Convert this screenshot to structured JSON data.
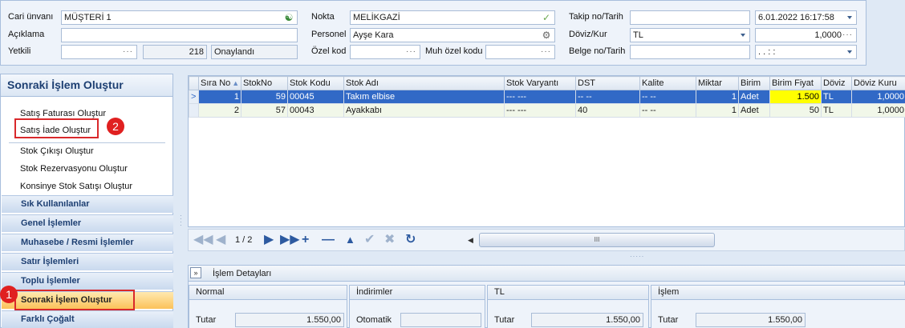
{
  "header": {
    "cari_label": "Cari ünvanı",
    "cari_value": "MÜŞTERİ 1",
    "aciklama_label": "Açıklama",
    "yetkili_label": "Yetkili",
    "yetkili_dots": "···",
    "count": "218",
    "status": "Onaylandı",
    "nokta_label": "Nokta",
    "nokta_value": "MELİKGAZİ",
    "personel_label": "Personel",
    "personel_value": "Ayşe Kara",
    "ozelkod_label": "Özel kod",
    "ozelkod_dots": "···",
    "muhozelkod_label": "Muh özel kodu",
    "muhozelkod_dots": "···",
    "takip_label": "Takip no/Tarih",
    "takip_date": "6.01.2022 16:17:58",
    "doviz_label": "Döviz/Kur",
    "doviz_value": "TL",
    "kur_value": "1,0000",
    "kur_dots": "···",
    "belge_label": "Belge no/Tarih",
    "belge_date": ".   .     :   :"
  },
  "left_panel": {
    "title": "Sonraki İşlem Oluştur",
    "items": [
      "Satış Faturası Oluştur",
      "Satış İade Oluştur",
      "Stok Çıkışı Oluştur",
      "Stok Rezervasyonu Oluştur",
      "Konsinye Stok Satışı Oluştur"
    ],
    "groups": [
      "Sık Kullanılanlar",
      "Genel İşlemler",
      "Muhasebe / Resmi İşlemler",
      "Satır İşlemleri",
      "Toplu İşlemler",
      "Sonraki İşlem Oluştur",
      "Farklı Çoğalt"
    ],
    "badge1": "1",
    "badge2": "2"
  },
  "grid": {
    "columns": [
      "Sıra No",
      "StokNo",
      "Stok Kodu",
      "Stok Adı",
      "Stok Varyantı",
      "DST",
      "Kalite",
      "Miktar",
      "Birim",
      "Birim Fiyat",
      "Döviz",
      "Döviz Kuru"
    ],
    "rows": [
      {
        "indicator": ">",
        "sira": "1",
        "stokno": "59",
        "kod": "00045",
        "ad": "Takım elbise",
        "varyant": "--- ---",
        "dst": "-- --",
        "kalite": "-- --",
        "miktar": "1",
        "birim": "Adet",
        "fiyat": "1.500",
        "doviz": "TL",
        "kur": "1,0000"
      },
      {
        "indicator": "",
        "sira": "2",
        "stokno": "57",
        "kod": "00043",
        "ad": "Ayakkabı",
        "varyant": "--- ---",
        "dst": "40",
        "kalite": "-- --",
        "miktar": "1",
        "birim": "Adet",
        "fiyat": "50",
        "doviz": "TL",
        "kur": "1,0000"
      }
    ]
  },
  "navigator": {
    "page": "1 / 2",
    "scroll_grip": "III"
  },
  "detail": {
    "title": "İşlem Detayları",
    "groups": [
      {
        "title": "Normal",
        "label": "Tutar",
        "value": "1.550,00"
      },
      {
        "title": "İndirimler",
        "label": "Otomatik",
        "value": ""
      },
      {
        "title": "TL",
        "label": "Tutar",
        "value": "1.550,00"
      },
      {
        "title": "İşlem",
        "label": "Tutar",
        "value": "1.550,00"
      }
    ]
  },
  "colors": {
    "selection": "#3169c6",
    "highlight": "#ffff00",
    "red": "#d9282b",
    "active_group": "#fbc25a"
  }
}
